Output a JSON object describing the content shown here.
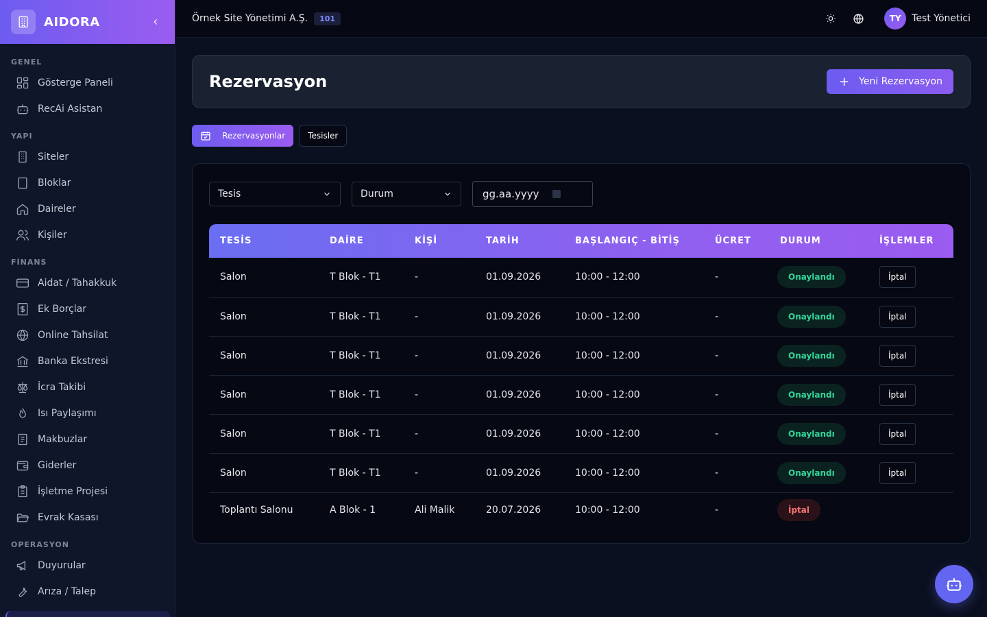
{
  "brand": {
    "name": "AIDORA"
  },
  "sidebar": {
    "sections": {
      "genel": "GENEL",
      "yapi": "YAPI",
      "finans": "FİNANS",
      "operasyon": "OPERASYON"
    },
    "items": {
      "dashboard": "Gösterge Paneli",
      "recai": "RecAi Asistan",
      "siteler": "Siteler",
      "bloklar": "Bloklar",
      "daireler": "Daireler",
      "kisiler": "Kişiler",
      "aidat": "Aidat / Tahakkuk",
      "ek_borclar": "Ek Borçlar",
      "online": "Online Tahsilat",
      "banka": "Banka Ekstresi",
      "icra": "İcra Takibi",
      "isi": "Isı Paylaşımı",
      "makbuzlar": "Makbuzlar",
      "giderler": "Giderler",
      "isletme": "İşletme Projesi",
      "evrak": "Evrak Kasası",
      "duyurular": "Duyurular",
      "ariza": "Arıza / Talep"
    }
  },
  "topbar": {
    "org_name": "Örnek Site Yönetimi A.Ş.",
    "org_badge": "101",
    "user_initials": "TY",
    "user_name": "Test Yönetici"
  },
  "page": {
    "title": "Rezervasyon",
    "new_button": "Yeni Rezervasyon",
    "tabs": {
      "reservations": "Rezervasyonlar",
      "facilities": "Tesisler"
    }
  },
  "filters": {
    "facility": "Tesis",
    "status": "Durum",
    "date_placeholder": "gg.aa.yyyy"
  },
  "table": {
    "headers": {
      "tesis": "TESİS",
      "daire": "DAİRE",
      "kisi": "KİŞİ",
      "tarih": "TARİH",
      "saat": "BAŞLANGIÇ - BİTİŞ",
      "ucret": "ÜCRET",
      "durum": "DURUM",
      "islemler": "İŞLEMLER"
    },
    "rows": [
      {
        "tesis": "Salon",
        "daire": "T Blok - T1",
        "kisi": "-",
        "tarih": "01.09.2026",
        "saat": "10:00 - 12:00",
        "ucret": "-",
        "durum": "Onaylandı",
        "islem": "İptal"
      },
      {
        "tesis": "Salon",
        "daire": "T Blok - T1",
        "kisi": "-",
        "tarih": "01.09.2026",
        "saat": "10:00 - 12:00",
        "ucret": "-",
        "durum": "Onaylandı",
        "islem": "İptal"
      },
      {
        "tesis": "Salon",
        "daire": "T Blok - T1",
        "kisi": "-",
        "tarih": "01.09.2026",
        "saat": "10:00 - 12:00",
        "ucret": "-",
        "durum": "Onaylandı",
        "islem": "İptal"
      },
      {
        "tesis": "Salon",
        "daire": "T Blok - T1",
        "kisi": "-",
        "tarih": "01.09.2026",
        "saat": "10:00 - 12:00",
        "ucret": "-",
        "durum": "Onaylandı",
        "islem": "İptal"
      },
      {
        "tesis": "Salon",
        "daire": "T Blok - T1",
        "kisi": "-",
        "tarih": "01.09.2026",
        "saat": "10:00 - 12:00",
        "ucret": "-",
        "durum": "Onaylandı",
        "islem": "İptal"
      },
      {
        "tesis": "Salon",
        "daire": "T Blok - T1",
        "kisi": "-",
        "tarih": "01.09.2026",
        "saat": "10:00 - 12:00",
        "ucret": "-",
        "durum": "Onaylandı",
        "islem": "İptal"
      },
      {
        "tesis": "Toplantı Salonu",
        "daire": "A Blok - 1",
        "kisi": "Ali Malik",
        "tarih": "20.07.2026",
        "saat": "10:00 - 12:00",
        "ucret": "-",
        "durum": "İptal",
        "islem": ""
      }
    ]
  },
  "colors": {
    "accent": "#6d5cf0",
    "accent_end": "#9b5cf0",
    "status_ok": "#34d399",
    "status_cancel": "#f87171"
  }
}
